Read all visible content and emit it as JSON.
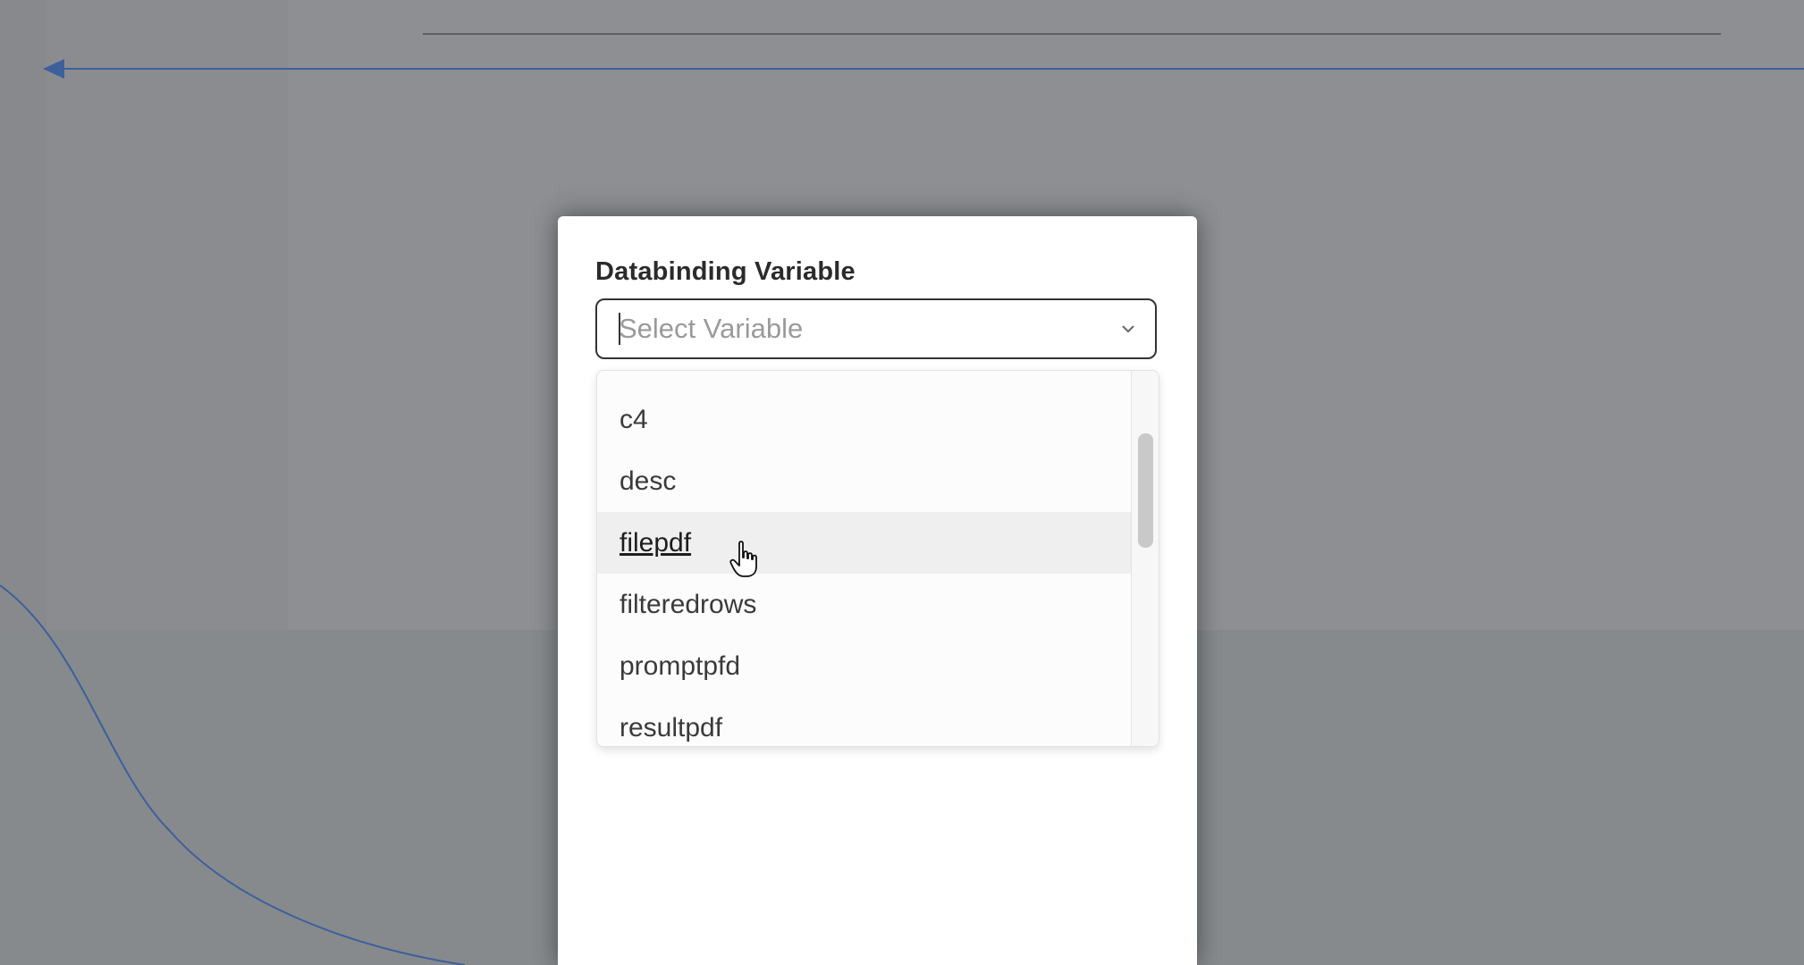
{
  "dialog": {
    "field_label": "Databinding Variable",
    "select": {
      "placeholder": "Select Variable",
      "value": ""
    },
    "options": [
      "c4",
      "desc",
      "filepdf",
      "filteredrows",
      "promptpfd",
      "resultpdf"
    ],
    "hovered_option": "filepdf"
  },
  "icons": {
    "chevron": "chevron-down-icon",
    "cursor": "hand-pointer-icon",
    "arrow": "arrow-left-icon"
  },
  "colors": {
    "overlay": "#88898d",
    "connector": "#3d5f9c"
  }
}
